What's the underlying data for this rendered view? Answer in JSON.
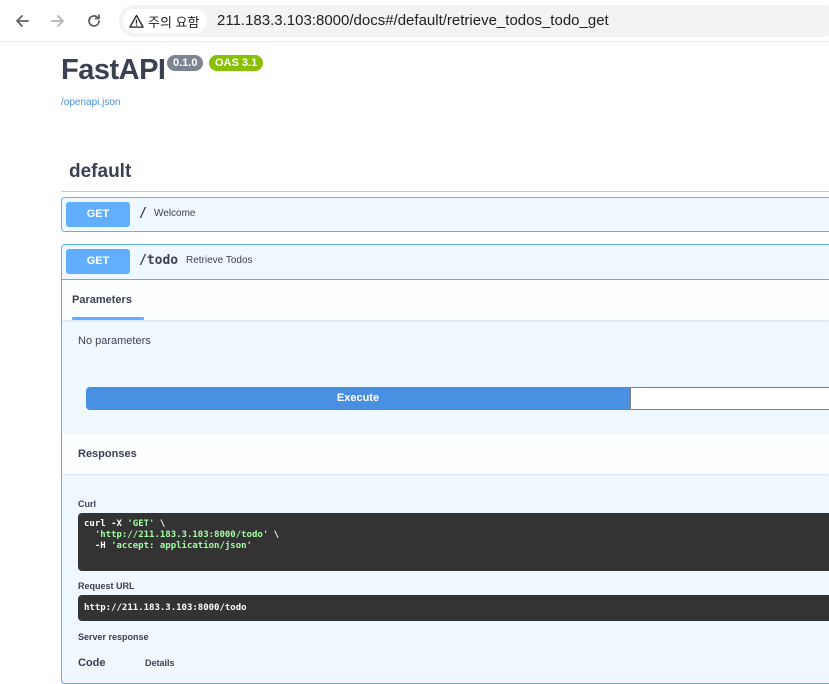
{
  "browser": {
    "security_label": "주의 요함",
    "url": "211.183.3.103:8000/docs#/default/retrieve_todos_todo_get"
  },
  "app": {
    "title": "FastAPI",
    "version_badge": "0.1.0",
    "oas_badge": "OAS 3.1",
    "openapi_link": "/openapi.json"
  },
  "tag": {
    "name": "default"
  },
  "operations": [
    {
      "method": "GET",
      "path": "/",
      "summary": "Welcome"
    },
    {
      "method": "GET",
      "path": "/todo",
      "summary": "Retrieve Todos"
    }
  ],
  "details": {
    "parameters_tab": "Parameters",
    "no_parameters": "No parameters",
    "execute_label": "Execute",
    "responses_label": "Responses",
    "curl_label": "Curl",
    "curl_line1_cmd": "curl -X ",
    "curl_line1_method": "'GET'",
    "curl_line1_end": " \\",
    "curl_line2_url": "'http://211.183.3.103:8000/todo'",
    "curl_line2_end": " \\",
    "curl_line3_flag": "  -H ",
    "curl_line3_header": "'accept: application/json'",
    "request_url_label": "Request URL",
    "request_url": "http://211.183.3.103:8000/todo",
    "server_response_label": "Server response",
    "code_col": "Code",
    "details_col": "Details"
  },
  "colors": {
    "get_method": "#61affe",
    "execute": "#4990e2",
    "version_badge": "#7d8492",
    "oas_badge": "#89bf04"
  }
}
